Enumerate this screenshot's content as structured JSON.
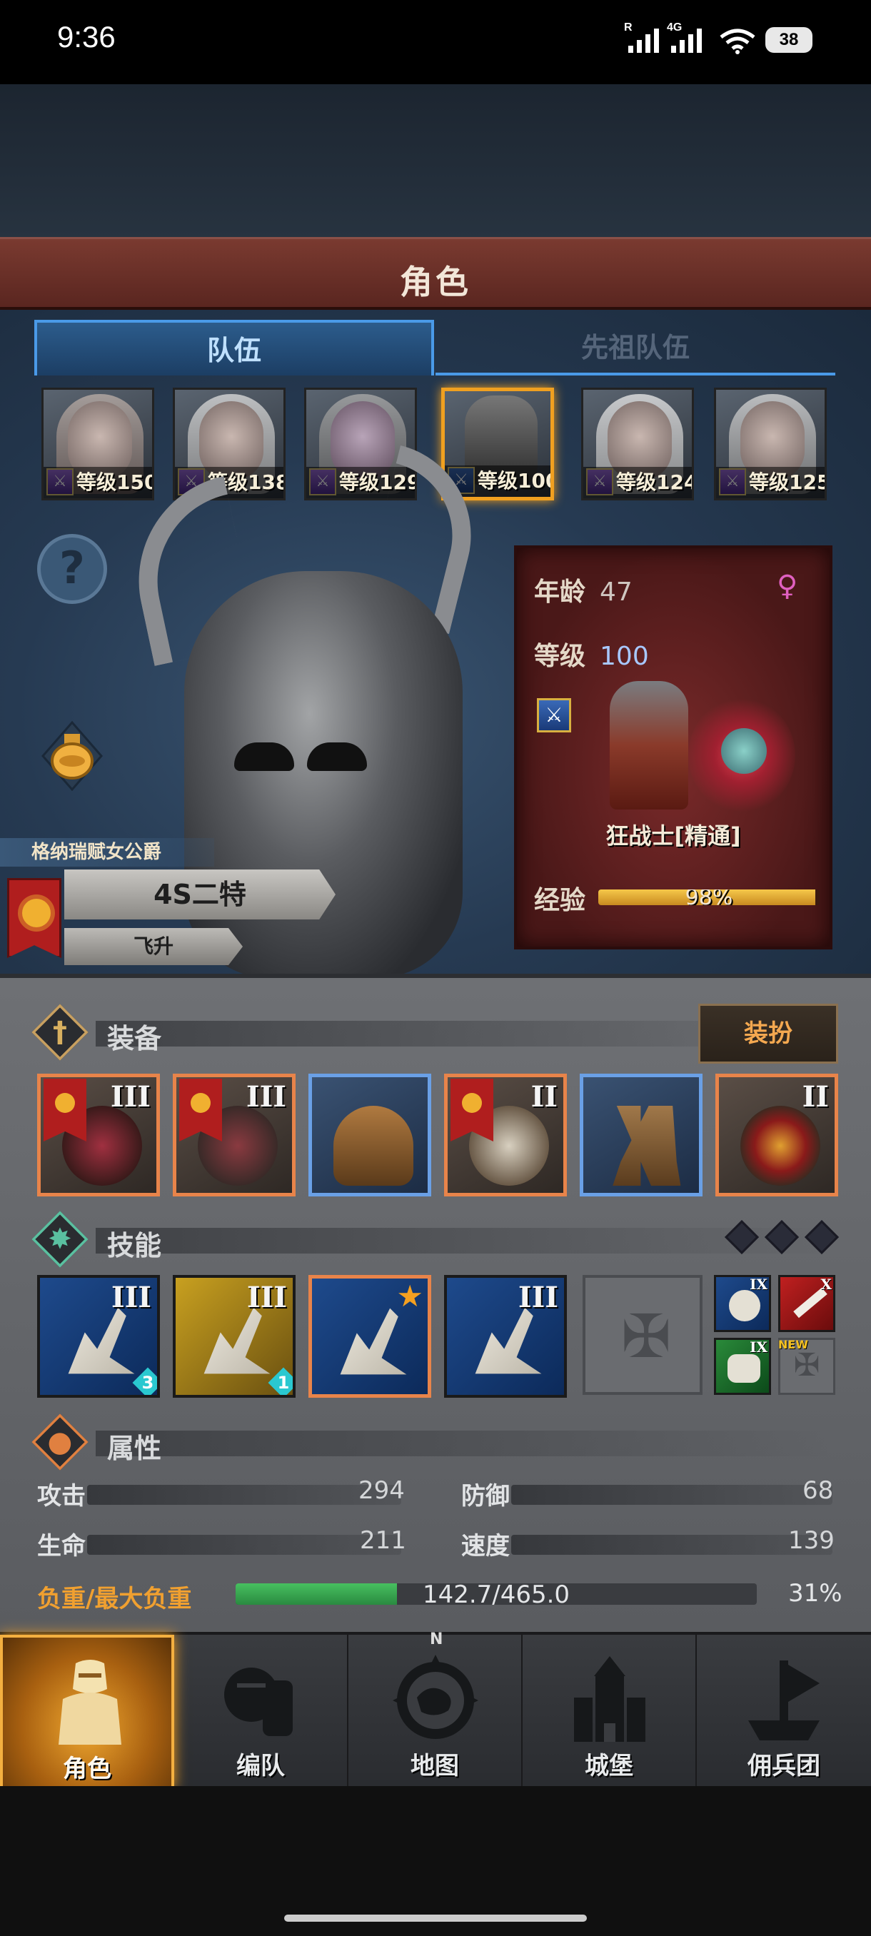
{
  "status_bar": {
    "time": "9:36",
    "sim1_label": "R",
    "sim2_label": "4G",
    "battery": "38"
  },
  "header": {
    "title": "角色"
  },
  "tabs": [
    {
      "label": "队伍",
      "active": true
    },
    {
      "label": "先祖队伍",
      "active": false
    }
  ],
  "party": [
    {
      "level": "等级150"
    },
    {
      "level": "等级138"
    },
    {
      "level": "等级129"
    },
    {
      "level": "等级100",
      "selected": true
    },
    {
      "level": "等级124"
    },
    {
      "level": "等级125"
    }
  ],
  "hero": {
    "title": "格纳瑞赋女公爵",
    "name": "4S二特",
    "status": "飞升",
    "help_icon": "?"
  },
  "info": {
    "age_label": "年龄",
    "age": "47",
    "level_label": "等级",
    "level": "100",
    "gender_icon": "♀",
    "class_name": "狂战士[精通]",
    "exp_label": "经验",
    "exp_percent": "98%",
    "exp_value": 0.98
  },
  "equipment": {
    "label": "装备",
    "dress_button": "装扮",
    "slots": [
      {
        "tier": "III",
        "rarity": "orange"
      },
      {
        "tier": "III",
        "rarity": "orange"
      },
      {
        "tier": "",
        "rarity": "blue"
      },
      {
        "tier": "II",
        "rarity": "orange"
      },
      {
        "tier": "",
        "rarity": "blue"
      },
      {
        "tier": "II",
        "rarity": "orange"
      }
    ]
  },
  "skills": {
    "label": "技能",
    "slots": [
      {
        "tier": "III",
        "gem": "3"
      },
      {
        "tier": "III",
        "gem": "1"
      },
      {
        "tier": "",
        "star": "★"
      },
      {
        "tier": "III"
      }
    ],
    "extra": [
      {
        "tier": "IX"
      },
      {
        "tier": "X"
      },
      {
        "tier": "IX"
      }
    ],
    "new_badge": "NEW"
  },
  "attributes": {
    "label": "属性",
    "attack_label": "攻击",
    "attack": "294",
    "defense_label": "防御",
    "defense": "68",
    "hp_label": "生命",
    "hp": "211",
    "speed_label": "速度",
    "speed": "139",
    "load_label": "负重/最大负重",
    "load_value": "142.7/465.0",
    "load_percent": "31%",
    "load_fraction": 0.31
  },
  "nav": [
    {
      "label": "角色",
      "active": true
    },
    {
      "label": "编队"
    },
    {
      "label": "地图"
    },
    {
      "label": "城堡"
    },
    {
      "label": "佣兵团"
    }
  ],
  "compass_n": "N",
  "colors": {
    "accent_orange": "#f0a030",
    "tab_blue": "#4a9ae8",
    "banner_red": "#7a3a30"
  }
}
